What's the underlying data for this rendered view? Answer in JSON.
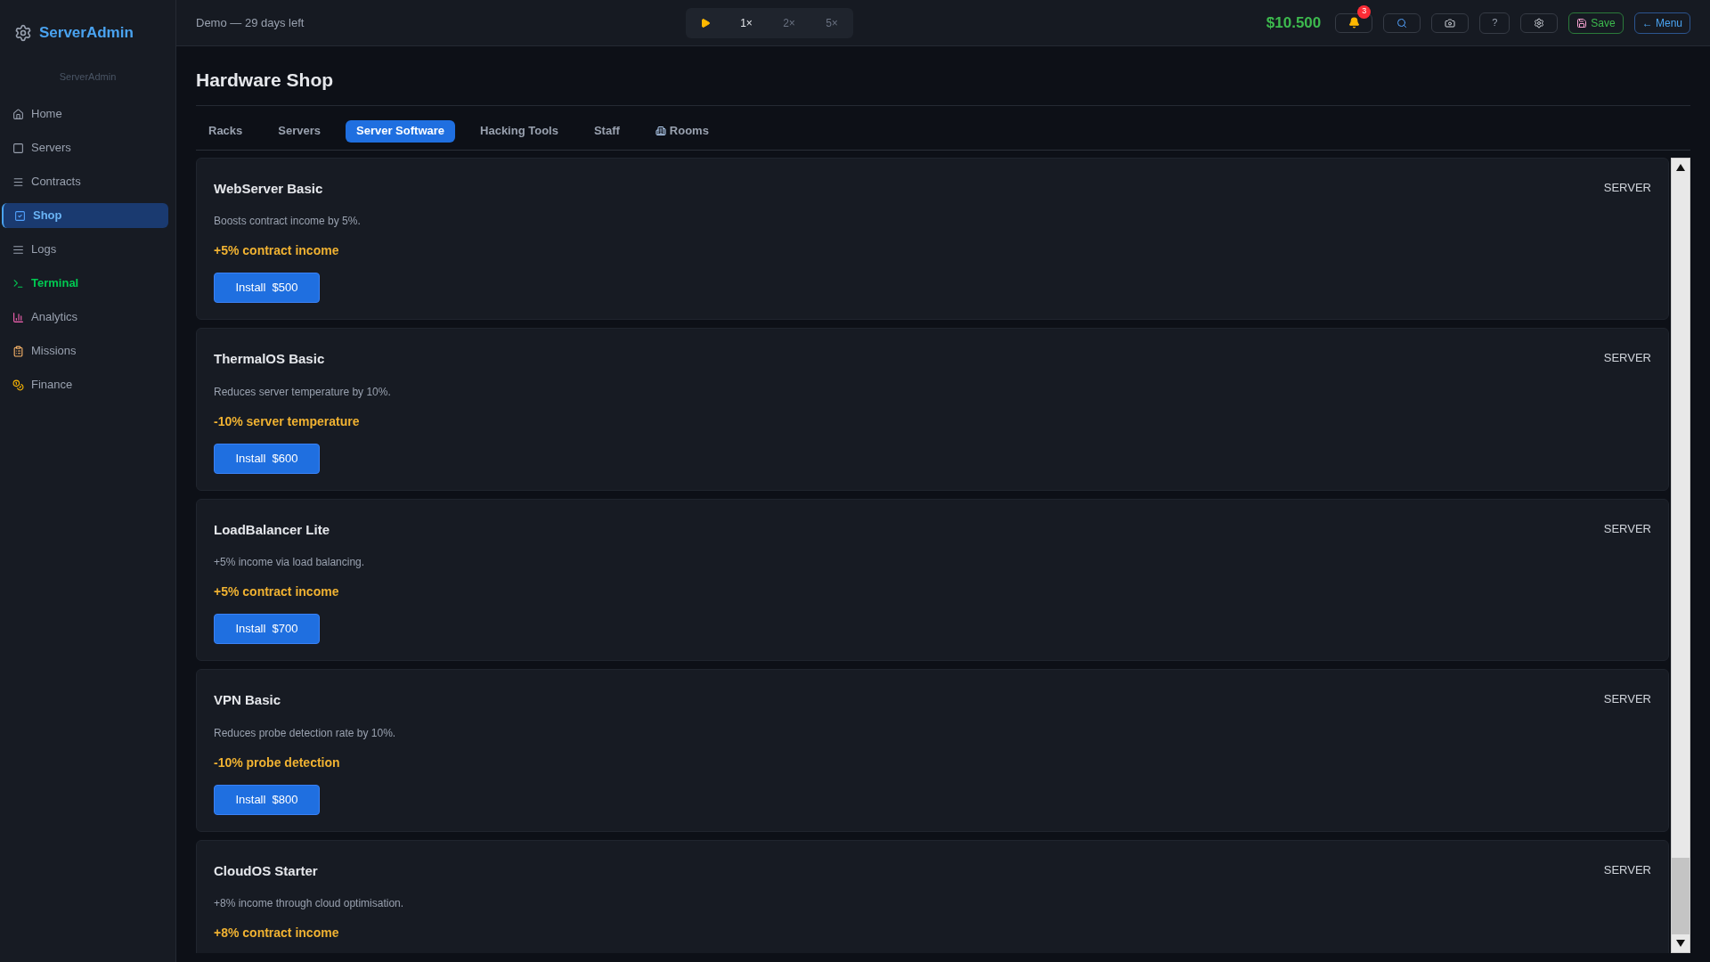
{
  "sidebar": {
    "brand": "ServerAdmin",
    "subtitle": "ServerAdmin",
    "items": [
      {
        "label": "Home",
        "selected": false,
        "kind": "normal"
      },
      {
        "label": "Servers",
        "selected": false,
        "kind": "normal"
      },
      {
        "label": "Contracts",
        "selected": false,
        "kind": "normal"
      },
      {
        "label": "Shop",
        "selected": true,
        "kind": "normal"
      },
      {
        "label": "Logs",
        "selected": false,
        "kind": "normal"
      },
      {
        "label": "Terminal",
        "selected": false,
        "kind": "terminal"
      },
      {
        "label": "Analytics",
        "selected": false,
        "kind": "normal"
      },
      {
        "label": "Missions",
        "selected": false,
        "kind": "normal"
      },
      {
        "label": "Finance",
        "selected": false,
        "kind": "normal"
      }
    ]
  },
  "top_bar": {
    "demo": "Demo — 29 days left",
    "speeds": [
      {
        "label": "1×",
        "disabled": false
      },
      {
        "label": "2×",
        "disabled": true
      },
      {
        "label": "5×",
        "disabled": true
      }
    ],
    "money": "$10.500",
    "notifications": "3",
    "help": "?",
    "save": "Save",
    "menu": "← Menu"
  },
  "page": {
    "title": "Hardware Shop",
    "tabs": [
      {
        "label": "Racks",
        "selected": false
      },
      {
        "label": "Servers",
        "selected": false
      },
      {
        "label": "Server Software",
        "selected": true
      },
      {
        "label": "Hacking Tools",
        "selected": false
      },
      {
        "label": "Staff",
        "selected": false
      },
      {
        "label": "Rooms",
        "selected": false,
        "kind": "with-icon"
      }
    ],
    "items": [
      {
        "name": "WebServer Basic",
        "category": "SERVER",
        "description": "Boosts contract income by 5%.",
        "effect": "+5% contract income",
        "button": "Install  $500"
      },
      {
        "name": "ThermalOS Basic",
        "category": "SERVER",
        "description": "Reduces server temperature by 10%.",
        "effect": "-10% server temperature",
        "button": "Install  $600"
      },
      {
        "name": "LoadBalancer Lite",
        "category": "SERVER",
        "description": "+5% income via load balancing.",
        "effect": "+5% contract income",
        "button": "Install  $700"
      },
      {
        "name": "VPN Basic",
        "category": "SERVER",
        "description": "Reduces probe detection rate by 10%.",
        "effect": "-10% probe detection",
        "button": "Install  $800"
      },
      {
        "name": "CloudOS Starter",
        "category": "SERVER",
        "description": "+8% income through cloud optimisation.",
        "effect": "+8% contract income"
      }
    ]
  }
}
